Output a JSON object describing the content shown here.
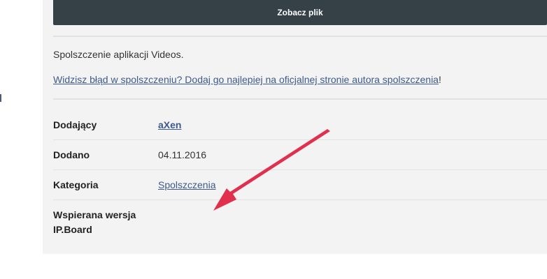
{
  "actions": {
    "view_file_label": "Zobacz plik"
  },
  "description": {
    "text": "Spolszczenie aplikacji Videos."
  },
  "report": {
    "link_text": "Widzisz błąd w spolszczeniu? Dodaj go najlepiej na oficjalnej stronie autora spolszczenia",
    "suffix": "!"
  },
  "details": {
    "submitter_label": "Dodający",
    "submitter_value": "aXen",
    "added_label": "Dodano",
    "added_value": "04.11.2016",
    "category_label": "Kategoria",
    "category_value": "Spolszczenia",
    "version_label": "Wspierana wersja IP.Board",
    "version_value": ""
  },
  "colors": {
    "button_bg": "#354047",
    "panel_bg": "#f3f3f3",
    "link": "#3d5a8a",
    "arrow": "#e0304e"
  },
  "annotation": {
    "icon": "red-arrow"
  }
}
